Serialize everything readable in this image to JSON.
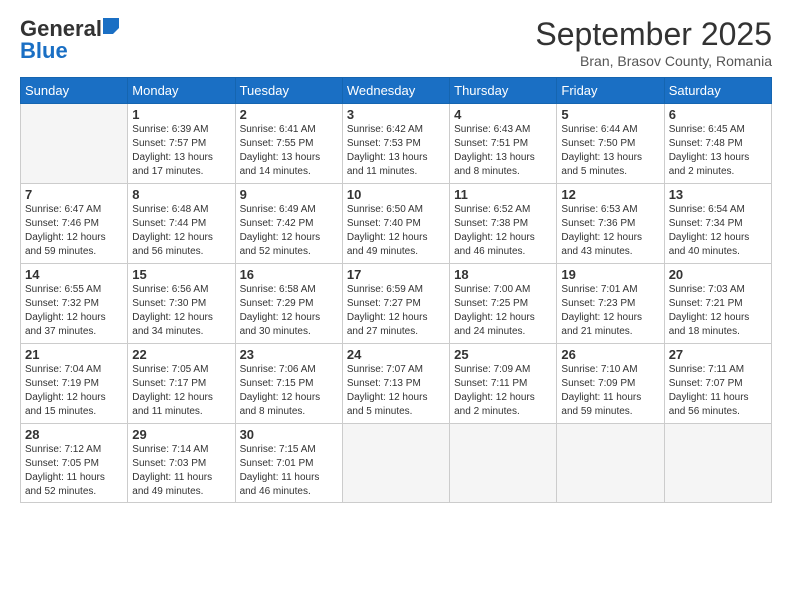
{
  "header": {
    "logo_line1": "General",
    "logo_line2": "Blue",
    "month": "September 2025",
    "location": "Bran, Brasov County, Romania"
  },
  "weekdays": [
    "Sunday",
    "Monday",
    "Tuesday",
    "Wednesday",
    "Thursday",
    "Friday",
    "Saturday"
  ],
  "weeks": [
    [
      {
        "day": "",
        "info": ""
      },
      {
        "day": "1",
        "info": "Sunrise: 6:39 AM\nSunset: 7:57 PM\nDaylight: 13 hours\nand 17 minutes."
      },
      {
        "day": "2",
        "info": "Sunrise: 6:41 AM\nSunset: 7:55 PM\nDaylight: 13 hours\nand 14 minutes."
      },
      {
        "day": "3",
        "info": "Sunrise: 6:42 AM\nSunset: 7:53 PM\nDaylight: 13 hours\nand 11 minutes."
      },
      {
        "day": "4",
        "info": "Sunrise: 6:43 AM\nSunset: 7:51 PM\nDaylight: 13 hours\nand 8 minutes."
      },
      {
        "day": "5",
        "info": "Sunrise: 6:44 AM\nSunset: 7:50 PM\nDaylight: 13 hours\nand 5 minutes."
      },
      {
        "day": "6",
        "info": "Sunrise: 6:45 AM\nSunset: 7:48 PM\nDaylight: 13 hours\nand 2 minutes."
      }
    ],
    [
      {
        "day": "7",
        "info": "Sunrise: 6:47 AM\nSunset: 7:46 PM\nDaylight: 12 hours\nand 59 minutes."
      },
      {
        "day": "8",
        "info": "Sunrise: 6:48 AM\nSunset: 7:44 PM\nDaylight: 12 hours\nand 56 minutes."
      },
      {
        "day": "9",
        "info": "Sunrise: 6:49 AM\nSunset: 7:42 PM\nDaylight: 12 hours\nand 52 minutes."
      },
      {
        "day": "10",
        "info": "Sunrise: 6:50 AM\nSunset: 7:40 PM\nDaylight: 12 hours\nand 49 minutes."
      },
      {
        "day": "11",
        "info": "Sunrise: 6:52 AM\nSunset: 7:38 PM\nDaylight: 12 hours\nand 46 minutes."
      },
      {
        "day": "12",
        "info": "Sunrise: 6:53 AM\nSunset: 7:36 PM\nDaylight: 12 hours\nand 43 minutes."
      },
      {
        "day": "13",
        "info": "Sunrise: 6:54 AM\nSunset: 7:34 PM\nDaylight: 12 hours\nand 40 minutes."
      }
    ],
    [
      {
        "day": "14",
        "info": "Sunrise: 6:55 AM\nSunset: 7:32 PM\nDaylight: 12 hours\nand 37 minutes."
      },
      {
        "day": "15",
        "info": "Sunrise: 6:56 AM\nSunset: 7:30 PM\nDaylight: 12 hours\nand 34 minutes."
      },
      {
        "day": "16",
        "info": "Sunrise: 6:58 AM\nSunset: 7:29 PM\nDaylight: 12 hours\nand 30 minutes."
      },
      {
        "day": "17",
        "info": "Sunrise: 6:59 AM\nSunset: 7:27 PM\nDaylight: 12 hours\nand 27 minutes."
      },
      {
        "day": "18",
        "info": "Sunrise: 7:00 AM\nSunset: 7:25 PM\nDaylight: 12 hours\nand 24 minutes."
      },
      {
        "day": "19",
        "info": "Sunrise: 7:01 AM\nSunset: 7:23 PM\nDaylight: 12 hours\nand 21 minutes."
      },
      {
        "day": "20",
        "info": "Sunrise: 7:03 AM\nSunset: 7:21 PM\nDaylight: 12 hours\nand 18 minutes."
      }
    ],
    [
      {
        "day": "21",
        "info": "Sunrise: 7:04 AM\nSunset: 7:19 PM\nDaylight: 12 hours\nand 15 minutes."
      },
      {
        "day": "22",
        "info": "Sunrise: 7:05 AM\nSunset: 7:17 PM\nDaylight: 12 hours\nand 11 minutes."
      },
      {
        "day": "23",
        "info": "Sunrise: 7:06 AM\nSunset: 7:15 PM\nDaylight: 12 hours\nand 8 minutes."
      },
      {
        "day": "24",
        "info": "Sunrise: 7:07 AM\nSunset: 7:13 PM\nDaylight: 12 hours\nand 5 minutes."
      },
      {
        "day": "25",
        "info": "Sunrise: 7:09 AM\nSunset: 7:11 PM\nDaylight: 12 hours\nand 2 minutes."
      },
      {
        "day": "26",
        "info": "Sunrise: 7:10 AM\nSunset: 7:09 PM\nDaylight: 11 hours\nand 59 minutes."
      },
      {
        "day": "27",
        "info": "Sunrise: 7:11 AM\nSunset: 7:07 PM\nDaylight: 11 hours\nand 56 minutes."
      }
    ],
    [
      {
        "day": "28",
        "info": "Sunrise: 7:12 AM\nSunset: 7:05 PM\nDaylight: 11 hours\nand 52 minutes."
      },
      {
        "day": "29",
        "info": "Sunrise: 7:14 AM\nSunset: 7:03 PM\nDaylight: 11 hours\nand 49 minutes."
      },
      {
        "day": "30",
        "info": "Sunrise: 7:15 AM\nSunset: 7:01 PM\nDaylight: 11 hours\nand 46 minutes."
      },
      {
        "day": "",
        "info": ""
      },
      {
        "day": "",
        "info": ""
      },
      {
        "day": "",
        "info": ""
      },
      {
        "day": "",
        "info": ""
      }
    ]
  ]
}
